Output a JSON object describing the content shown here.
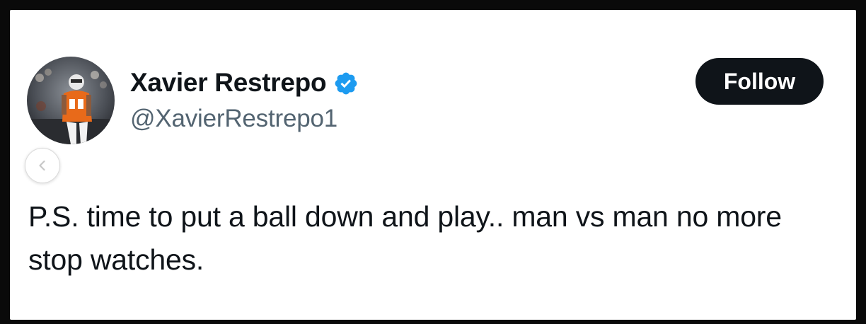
{
  "tweet": {
    "author": {
      "display_name": "Xavier Restrepo",
      "handle": "@XavierRestrepo1",
      "verified": true,
      "avatar_icon": "player-photo-avatar"
    },
    "follow_button_label": "Follow",
    "text": "P.S. time to put a ball down and play.. man vs man no more stop watches."
  },
  "carousel": {
    "prev_icon": "chevron-left-icon"
  },
  "colors": {
    "background_frame": "#0a0a0a",
    "card": "#ffffff",
    "primary_text": "#0f1419",
    "secondary_text": "#536471",
    "verified_blue": "#1d9bf0",
    "button_bg": "#0f1419",
    "button_text": "#ffffff"
  }
}
